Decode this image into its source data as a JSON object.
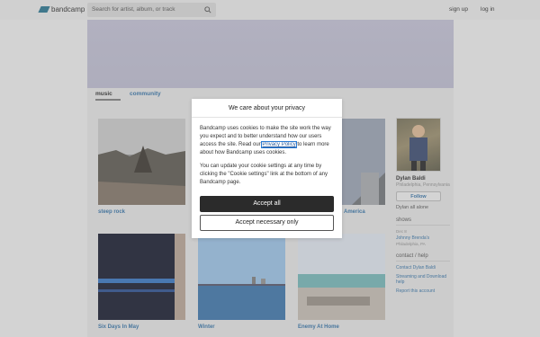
{
  "header": {
    "logo_text": "bandcamp",
    "search_placeholder": "Search for artist, album, or track",
    "signup": "sign up",
    "login": "log in"
  },
  "tabs": {
    "music": "music",
    "community": "community"
  },
  "albums": [
    {
      "title": "steep rock"
    },
    {
      "title": ""
    },
    {
      "title": "America"
    },
    {
      "title": "Six Days In May"
    },
    {
      "title": "Winter"
    },
    {
      "title": "Enemy At Home"
    }
  ],
  "sidebar": {
    "name": "Dylan Baldi",
    "location": "Philadelphia, Pennsylvania",
    "follow": "Follow",
    "subtitle": "Dylan all alone",
    "shows_heading": "shows",
    "show_date": "Dec 8",
    "show_venue": "Johnny Brenda's",
    "show_city": "Philadelphia, PA",
    "contact_heading": "contact / help",
    "contact_link": "Contact Dylan Baldi",
    "streaming_link": "Streaming and Download help",
    "report_link": "Report this account"
  },
  "cookie_modal": {
    "title": "We care about your privacy",
    "para1_before": "Bandcamp uses cookies to make the site work the way you expect and to better understand how our users access the site. Read our ",
    "privacy_link": "Privacy Policy",
    "para1_after": " to learn more about how Bandcamp uses cookies.",
    "para2": "You can update your cookie settings at any time by clicking the \"Cookie settings\" link at the bottom of any Bandcamp page.",
    "accept_all": "Accept all",
    "accept_necessary": "Accept necessary only"
  },
  "colors": {
    "link": "#3a6e9a",
    "accept_button": "#2b2b2b",
    "banner": "#b1b0c1"
  }
}
